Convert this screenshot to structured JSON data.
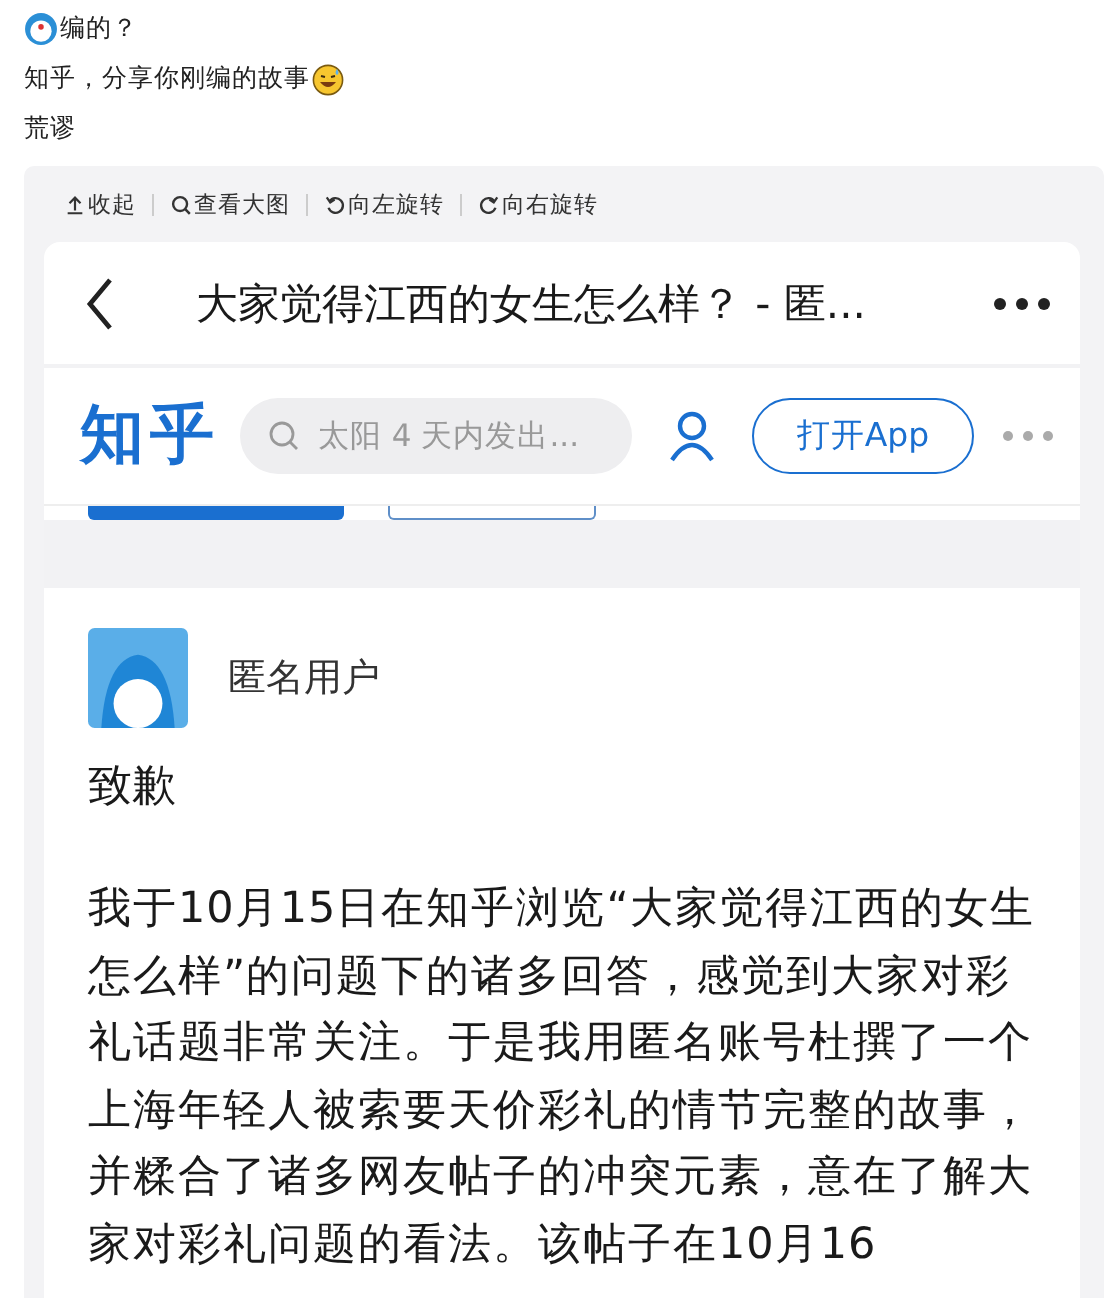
{
  "comments": [
    [
      {
        "kind": "avatar"
      },
      {
        "kind": "text",
        "text": "编的？"
      }
    ],
    [
      {
        "kind": "text",
        "text": "知乎，分享你刚编的故事"
      },
      {
        "kind": "emoji"
      }
    ],
    [
      {
        "kind": "text",
        "text": "荒谬"
      }
    ]
  ],
  "image_toolbar": [
    {
      "kind": "collapse",
      "label": "收起"
    },
    {
      "kind": "zoom",
      "label": "查看大图"
    },
    {
      "kind": "rotate-left",
      "label": "向左旋转"
    },
    {
      "kind": "rotate-right",
      "label": "向右旋转"
    }
  ],
  "screenshot": {
    "page_title": "大家觉得江西的女生怎么样？ - 匿...",
    "site_logo": "知乎",
    "search_placeholder": "太阳 4 天内发出...",
    "open_app_button": "打开App",
    "author": "匿名用户",
    "heading": "致歉",
    "body": "我于10月15日在知乎浏览“大家觉得江西的女生怎么样”的问题下的诸多回答，感觉到大家对彩礼话题非常关注。于是我用匿名账号杜撰了一个上海年轻人被索要天价彩礼的情节完整的故事，并糅合了诸多网友帖子的冲突元素，意在了解大家对彩礼问题的看法。该帖子在10月16"
  }
}
